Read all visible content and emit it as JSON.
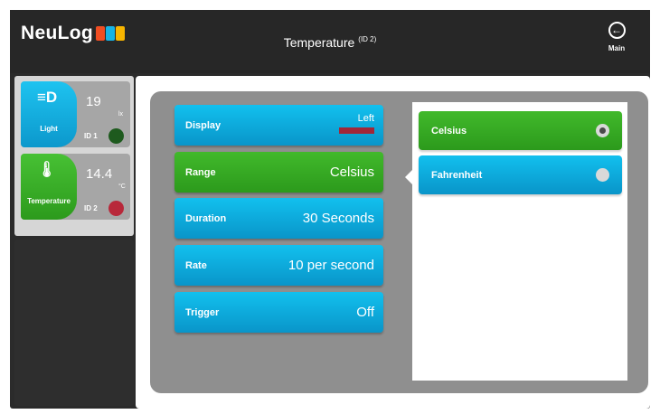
{
  "header": {
    "logo_text": "NeuLog",
    "logo_tile_colors": [
      "#f04e23",
      "#16b4e6",
      "#f7b500"
    ],
    "title": "Temperature",
    "title_sub": "(ID 2)",
    "main_label": "Main",
    "main_icon": "arrow-left-circle-icon"
  },
  "sensors": [
    {
      "name": "Light",
      "icon": "light-icon",
      "value": "19",
      "unit": "lx",
      "id_label": "ID 1",
      "tab_color": "#12b0e3",
      "status_color": "#1e5a1e"
    },
    {
      "name": "Temperature",
      "icon": "thermometer-icon",
      "value": "14.4",
      "unit": "°C",
      "id_label": "ID 2",
      "tab_color": "#3bb32a",
      "status_color": "#b8283a"
    }
  ],
  "settings": {
    "display": {
      "label": "Display",
      "value": "Left",
      "swatch_color": "#a12739"
    },
    "range": {
      "label": "Range",
      "value": "Celsius"
    },
    "duration": {
      "label": "Duration",
      "value": "30 Seconds"
    },
    "rate": {
      "label": "Rate",
      "value": "10 per second"
    },
    "trigger": {
      "label": "Trigger",
      "value": "Off"
    }
  },
  "options": [
    {
      "label": "Celsius",
      "selected": true
    },
    {
      "label": "Fahrenheit",
      "selected": false
    }
  ]
}
